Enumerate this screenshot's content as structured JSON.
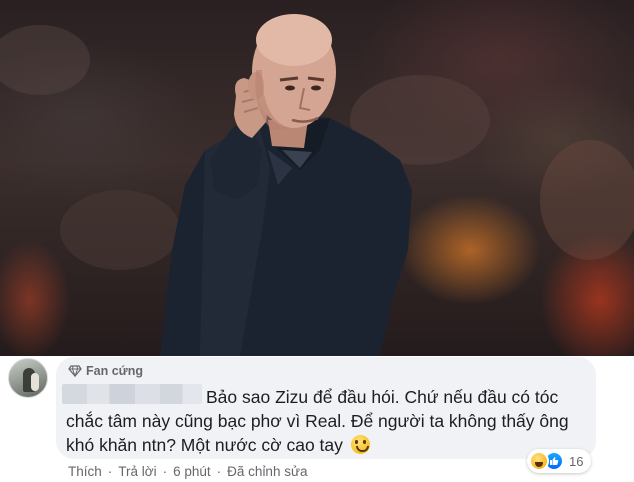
{
  "photo": {
    "subject": "man-in-dark-coat"
  },
  "comment": {
    "badge": {
      "icon": "diamond-icon",
      "label": "Fan cứng"
    },
    "lines": [
      "Bảo sao Zizu để đầu hói. Chứ nếu đầu có tóc",
      "chắc tâm này cũng bạc phơ vì Real. Để người ta không thấy ông",
      "khó khăn ntn? Một nước cờ cao tay"
    ],
    "emoji": "grinning-emoji"
  },
  "actions": {
    "like": "Thích",
    "reply": "Trả lời",
    "time": "6 phút",
    "edited": "Đã chỉnh sửa",
    "separator": "·"
  },
  "reactions": {
    "icons": [
      "haha-icon",
      "like-icon"
    ],
    "count": "16"
  },
  "colors": {
    "bubble": "#f0f2f5",
    "meta_text": "#65676b",
    "body_text": "#1c1e21",
    "like_blue": "#0368ff"
  }
}
